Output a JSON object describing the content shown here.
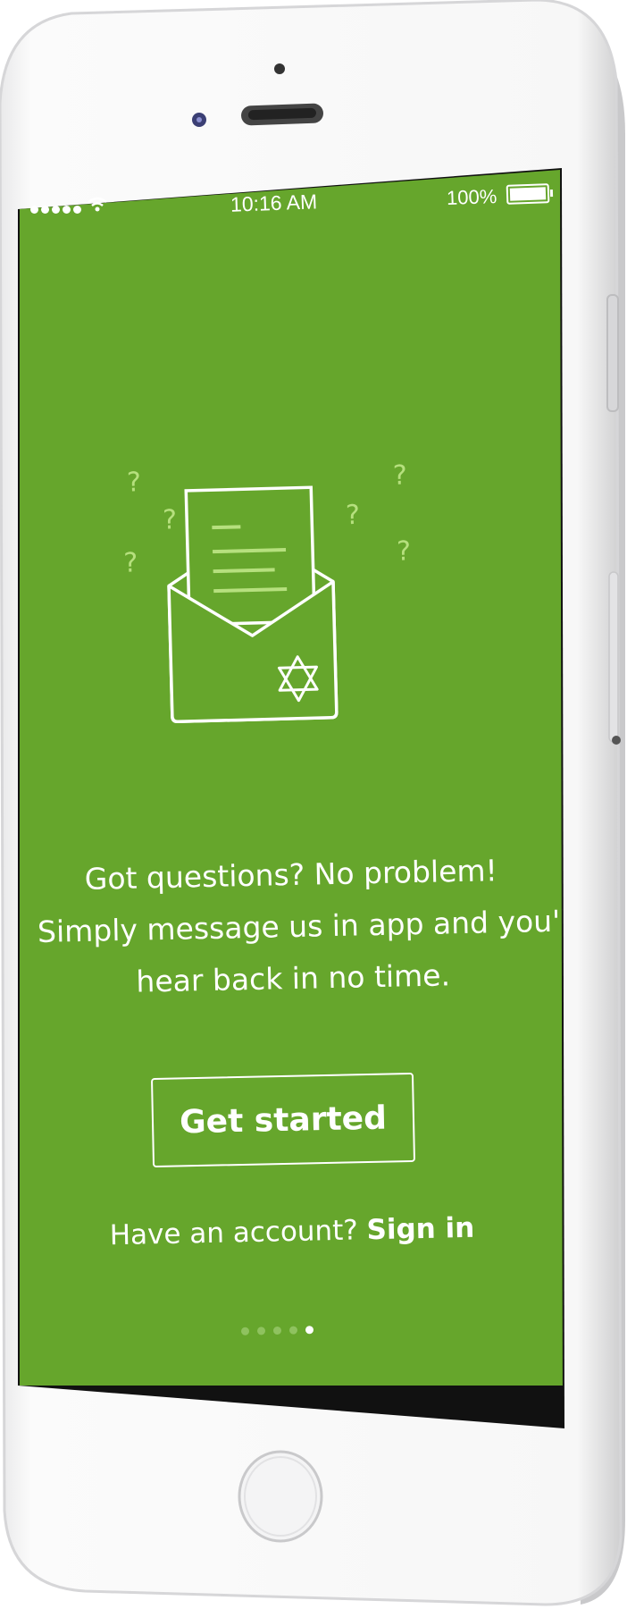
{
  "status_bar": {
    "time": "10:16 AM",
    "battery_percent": "100%",
    "signal_bars": 5
  },
  "illustration": {
    "icon": "envelope-letter-icon",
    "question_mark": "?"
  },
  "onboarding": {
    "message_line_1": "Got questions? No problem!",
    "message_line_2": "Simply message us in app and you'll",
    "message_line_3": "hear back in no time.",
    "cta_label": "Get started",
    "account_prompt": "Have an account?",
    "signin_label": "Sign in",
    "page_count": 5,
    "active_page": 5
  },
  "colors": {
    "screen_background": "#66a62c",
    "question_mark": "#b6e07e",
    "letter_lines": "#b6e07e",
    "text": "#ffffff",
    "dot_inactive": "#8fc25f",
    "dot_active": "#ffffff"
  }
}
